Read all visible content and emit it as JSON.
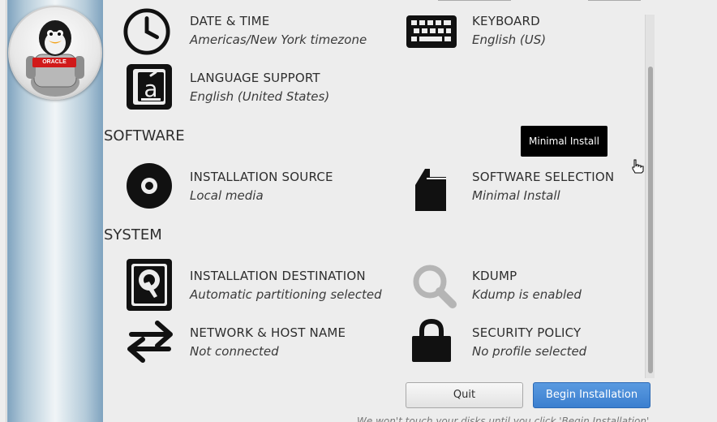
{
  "hub": {
    "spokes": {
      "date_time": {
        "title": "DATE & TIME",
        "status": "Americas/New York timezone",
        "icon": "clock-icon"
      },
      "keyboard": {
        "title": "KEYBOARD",
        "status": "English (US)",
        "icon": "keyboard-icon"
      },
      "language": {
        "title": "LANGUAGE SUPPORT",
        "status": "English (United States)",
        "icon": "language-icon"
      },
      "install_source": {
        "title": "INSTALLATION SOURCE",
        "status": "Local media",
        "icon": "disc-icon"
      },
      "software_selection": {
        "title": "SOFTWARE SELECTION",
        "status": "Minimal Install",
        "icon": "package-icon"
      },
      "install_destination": {
        "title": "INSTALLATION DESTINATION",
        "status": "Automatic partitioning selected",
        "icon": "harddisk-icon"
      },
      "kdump": {
        "title": "KDUMP",
        "status": "Kdump is enabled",
        "icon": "magnifier-icon"
      },
      "network": {
        "title": "NETWORK & HOST NAME",
        "status": "Not connected",
        "icon": "network-arrows-icon"
      },
      "security": {
        "title": "SECURITY POLICY",
        "status": "No profile selected",
        "icon": "lock-icon"
      }
    },
    "sections": {
      "software": "SOFTWARE",
      "system": "SYSTEM"
    }
  },
  "tooltip": {
    "text": "Minimal Install"
  },
  "buttons": {
    "quit": "Quit",
    "begin": "Begin Installation"
  },
  "footer": {
    "note": "We won't touch your disks until you click 'Begin Installation'."
  },
  "branding": {
    "badge": "ORACLE",
    "logo": "oracle-tux-logo"
  },
  "colors": {
    "background": "#ededed",
    "primary_button": "#3b7fcf",
    "icon_dark": "#111111",
    "icon_disabled": "#b5b5b5"
  }
}
